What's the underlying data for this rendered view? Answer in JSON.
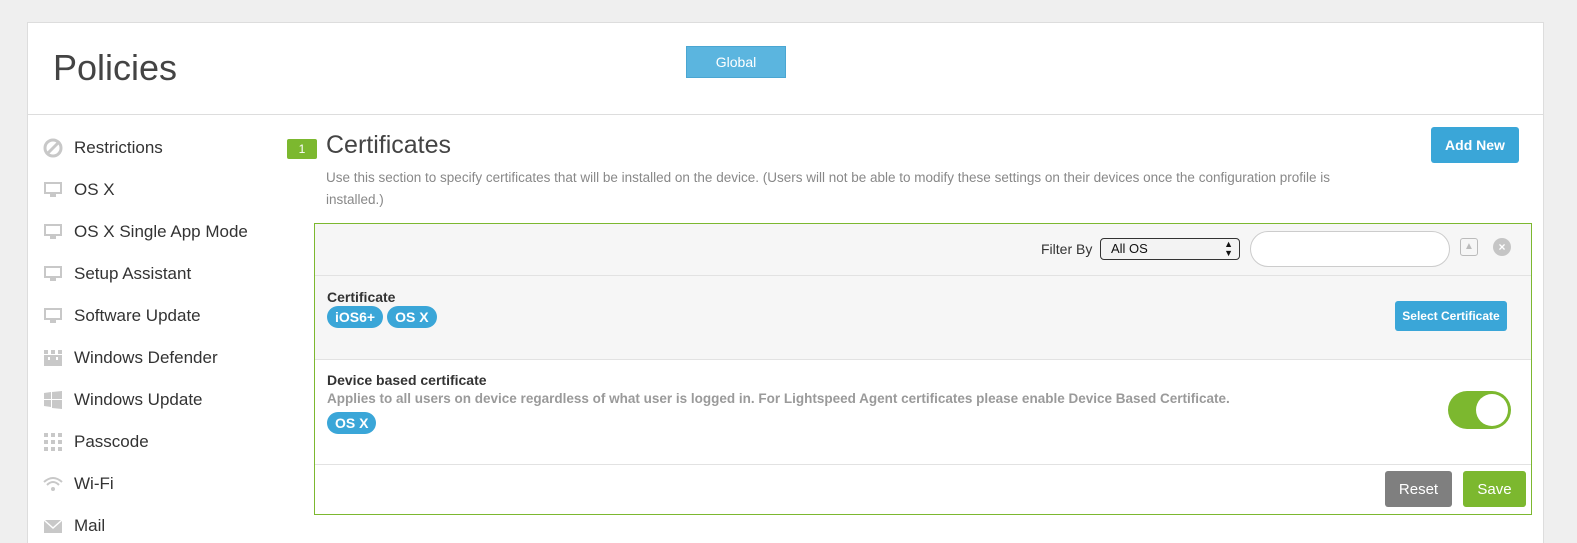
{
  "header": {
    "title": "Policies",
    "scope_button": "Global"
  },
  "sidebar": {
    "items": [
      {
        "label": "Restrictions",
        "icon": "restrictions-icon"
      },
      {
        "label": "OS X",
        "icon": "monitor-icon"
      },
      {
        "label": "OS X Single App Mode",
        "icon": "monitor-icon"
      },
      {
        "label": "Setup Assistant",
        "icon": "monitor-icon"
      },
      {
        "label": "Software Update",
        "icon": "monitor-icon"
      },
      {
        "label": "Windows Defender",
        "icon": "castle-icon"
      },
      {
        "label": "Windows Update",
        "icon": "windows-icon"
      },
      {
        "label": "Passcode",
        "icon": "keypad-icon"
      },
      {
        "label": "Wi-Fi",
        "icon": "wifi-icon"
      },
      {
        "label": "Mail",
        "icon": "mail-icon"
      }
    ]
  },
  "section": {
    "step": "1",
    "title": "Certificates",
    "add_button": "Add New",
    "description": "Use this section to specify certificates that will be installed on the device. (Users will not be able to modify these settings on their devices once the configuration profile is installed.)"
  },
  "filter": {
    "label": "Filter By",
    "selected": "All OS",
    "search_value": ""
  },
  "certificate": {
    "label": "Certificate",
    "tags": [
      "iOS6+",
      "OS X"
    ],
    "select_button": "Select Certificate"
  },
  "device_cert": {
    "label": "Device based certificate",
    "description": "Applies to all users on device regardless of what user is logged in. For Lightspeed Agent certificates please enable Device Based Certificate.",
    "tags": [
      "OS X"
    ],
    "enabled": true
  },
  "actions": {
    "reset": "Reset",
    "save": "Save"
  },
  "colors": {
    "accent_blue": "#3aa6d8",
    "accent_green": "#7cb82f",
    "reset_gray": "#7f7f7f"
  }
}
